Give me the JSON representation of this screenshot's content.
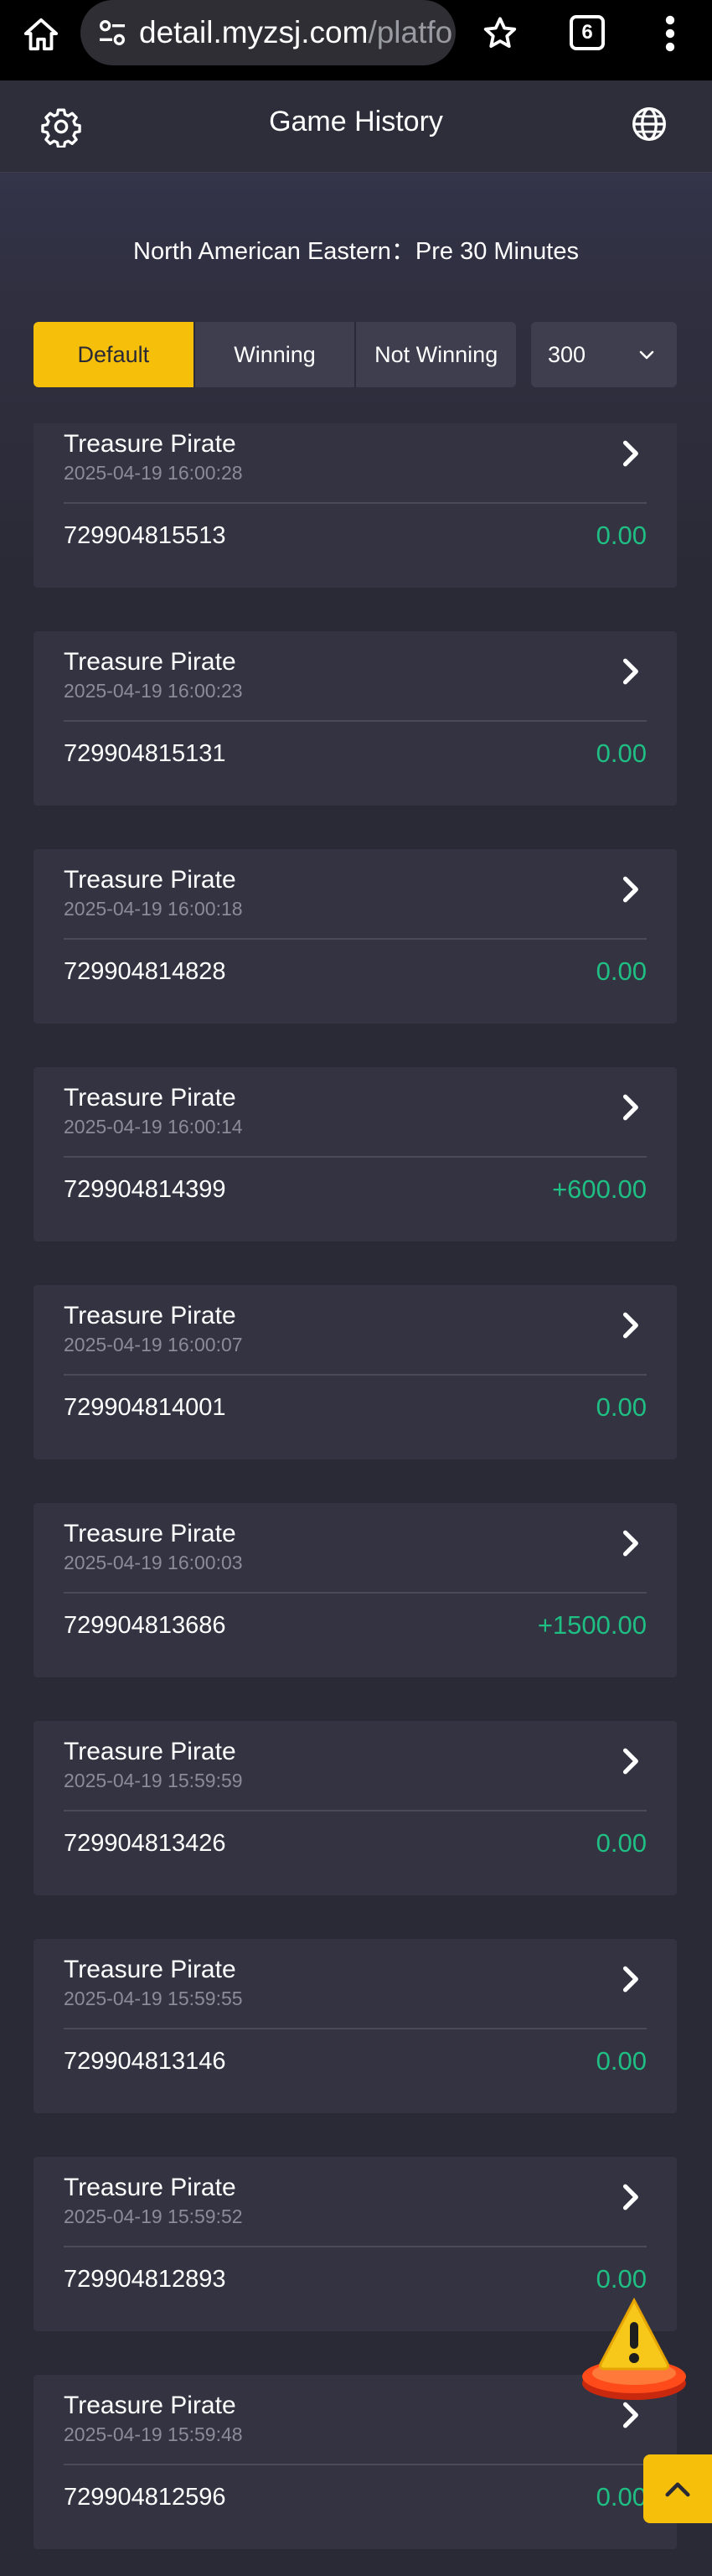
{
  "browser": {
    "url_host": "detail.myzsj.com",
    "url_path": "/platfo",
    "tab_count": "6",
    "icons": [
      "home-icon",
      "site-settings-icon",
      "bookmark-star-icon",
      "tabs-icon",
      "more-vert-icon"
    ]
  },
  "header": {
    "title": "Game History",
    "left_icon": "gear-icon",
    "right_icon": "globe-icon"
  },
  "timezone_notice": "North American Eastern：Pre 30 Minutes",
  "filters": {
    "options": [
      "Default",
      "Winning",
      "Not Winning"
    ],
    "active": "Default",
    "page_size": "300"
  },
  "records": [
    {
      "game": "Treasure Pirate",
      "time": "2025-04-19 16:00:28",
      "order_id": "729904815513",
      "win": "0.00"
    },
    {
      "game": "Treasure Pirate",
      "time": "2025-04-19 16:00:23",
      "order_id": "729904815131",
      "win": "0.00"
    },
    {
      "game": "Treasure Pirate",
      "time": "2025-04-19 16:00:18",
      "order_id": "729904814828",
      "win": "0.00"
    },
    {
      "game": "Treasure Pirate",
      "time": "2025-04-19 16:00:14",
      "order_id": "729904814399",
      "win": "+600.00"
    },
    {
      "game": "Treasure Pirate",
      "time": "2025-04-19 16:00:07",
      "order_id": "729904814001",
      "win": "0.00"
    },
    {
      "game": "Treasure Pirate",
      "time": "2025-04-19 16:00:03",
      "order_id": "729904813686",
      "win": "+1500.00"
    },
    {
      "game": "Treasure Pirate",
      "time": "2025-04-19 15:59:59",
      "order_id": "729904813426",
      "win": "0.00"
    },
    {
      "game": "Treasure Pirate",
      "time": "2025-04-19 15:59:55",
      "order_id": "729904813146",
      "win": "0.00"
    },
    {
      "game": "Treasure Pirate",
      "time": "2025-04-19 15:59:52",
      "order_id": "729904812893",
      "win": "0.00"
    },
    {
      "game": "Treasure Pirate",
      "time": "2025-04-19 15:59:48",
      "order_id": "729904812596",
      "win": "0.00"
    }
  ],
  "floating": {
    "warning_icon": "warning-icon",
    "back_to_top_icon": "chevron-up-icon"
  },
  "colors": {
    "accent": "#f5bf0a",
    "win_amount": "#1fbf84",
    "card_bg": "#333341",
    "page_bg": "#2a2a36"
  }
}
